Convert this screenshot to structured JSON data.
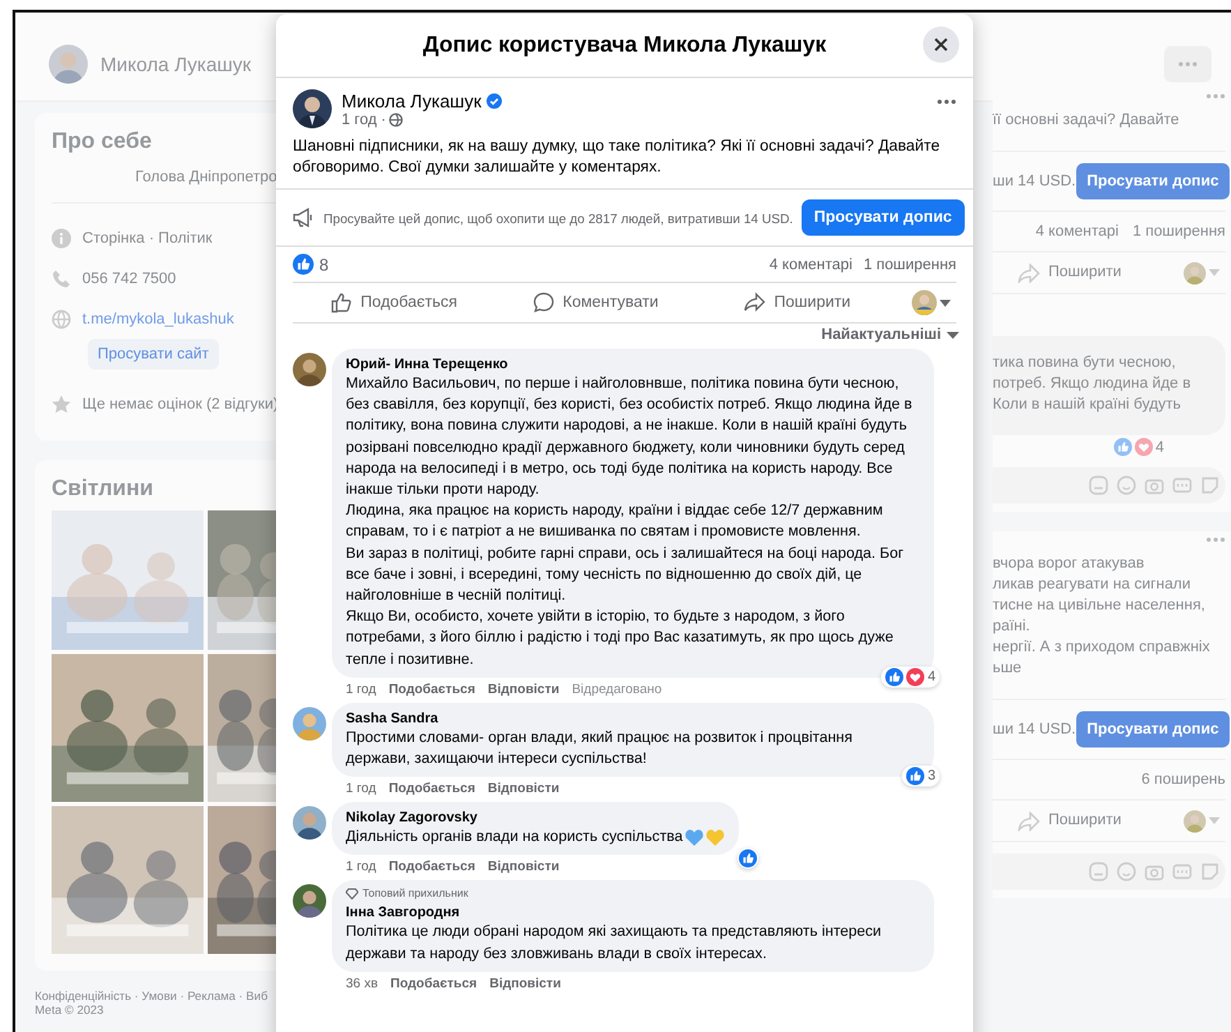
{
  "page_header": {
    "name": "Микола Лукашук"
  },
  "about": {
    "title": "Про себе",
    "bio": "Голова Дніпропетро",
    "items": [
      {
        "kind": "info",
        "text": "Сторінка · Політик"
      },
      {
        "kind": "phone",
        "text": "056 742 7500"
      },
      {
        "kind": "link",
        "text": "t.me/mykola_lukashuk"
      }
    ],
    "promote_button": "Просувати сайт",
    "rating": "Ще немає оцінок (2 відгуки)"
  },
  "photos": {
    "title": "Світлини"
  },
  "footer": [
    "Конфіденційність · Умови · Реклама · Виб",
    "Meta © 2023"
  ],
  "right_cards": [
    {
      "text_lines": [
        "її основні задачі? Давайте"
      ],
      "promo_fragment": "ши 14 USD.",
      "promote_button": "Просувати допис",
      "stats": [
        "4 коментарі",
        "1 поширення"
      ],
      "share": "Поширити",
      "comment_lines": [
        "тика повина бути чесною,",
        "потреб. Якщо людина йде в",
        "Коли в нашій країні будуть"
      ],
      "reaction_count": "4"
    },
    {
      "text_lines": [
        "вчора ворог атакував",
        "ликав реагувати на сигнали",
        "тисне на цивільне населення,",
        "раїні.",
        "нергії. А з приходом справжніх",
        "ьше"
      ],
      "promo_fragment": "ши 14 USD.",
      "promote_button": "Просувати допис",
      "stats": [
        "6 поширень"
      ],
      "share": "Поширити"
    }
  ],
  "modal": {
    "title": "Допис користувача Микола Лукашук",
    "post": {
      "author": "Микола Лукашук",
      "verified": true,
      "time": "1 год ·",
      "text": "Шановні підписники, як на вашу думку, що таке політика? Які її основні задачі? Давайте обговоримо. Свої думки залишайте у коментарях.",
      "promo": {
        "text": "Просувайте цей допис, щоб охопити ще до 2817 людей, витративши 14 USD.",
        "button": "Просувати допис"
      },
      "likes": "8",
      "stats": [
        "4 коментарі",
        "1 поширення"
      ],
      "actions": [
        {
          "kind": "like",
          "label": "Подобається"
        },
        {
          "kind": "comment",
          "label": "Коментувати"
        },
        {
          "kind": "share",
          "label": "Поширити"
        }
      ],
      "sort": "Найактуальніші"
    },
    "comments": [
      {
        "author": "Юрий- Инна Терещенко",
        "paragraphs": [
          "Михайло Васильович, по перше і найголовнвше, політика повина бути чесною, без свавілля, без корупції, без користі, без особистіх потреб. Якщо людина йде в політику, вона повина служити народові, а не інакше. Коли в нашій країні будуть розірвані повселюдно крадії державного бюджету, коли чиновники будуть серед народа на велосипеді і в метро, ось тоді буде політика на користь народу. Все інакше тільки проти народу.",
          "Людина, яка працює на користь народу, країни і віддає себе 12/7 державним справам, то і є патріот а не вишиванка по святам і промовисте мовлення.",
          "Ви зараз в політиці, робите гарні справи, ось і залишайтеся на боці народа. Бог все баче і зовні, і всередині, тому чесність по відношенню до своїх дій, це найголовніше в чесній політиці.",
          "Якщо Ви, особисто, хочете увійти в історію, то будьте з народом, з його потребами, з його біллю і радістю і тоді про Вас казатимуть, як про щось дуже тепле і позитивне."
        ],
        "time": "1 год",
        "actions": [
          "Подобається",
          "Відповісти"
        ],
        "edited": "Відредаговано",
        "reactions": [
          {
            "kind": "like"
          },
          {
            "kind": "love"
          }
        ],
        "reaction_count": "4"
      },
      {
        "author": "Sasha Sandra",
        "paragraphs": [
          "Простими словами- орган влади, який працює на розвиток і процвітання держави, захищаючи інтереси суспільства!"
        ],
        "time": "1 год",
        "actions": [
          "Подобається",
          "Відповісти"
        ],
        "reactions": [
          {
            "kind": "like"
          }
        ],
        "reaction_count": "3"
      },
      {
        "author": "Nikolay Zagorovsky",
        "paragraphs": [
          "Діяльність органів влади на користь суспільства"
        ],
        "emoji": [
          {
            "kind": "blue_heart"
          },
          {
            "kind": "yellow_heart"
          }
        ],
        "time": "1 год",
        "actions": [
          "Подобається",
          "Відповісти"
        ],
        "reactions": [
          {
            "kind": "like"
          }
        ]
      },
      {
        "author": "Інна Завгородня",
        "badge": "Топовий прихильник",
        "paragraphs": [
          "Політика це люди обрані народом які захищають та представляють інтереси держави та народу без зловживань влади в своїх інтересах."
        ],
        "time": "36 хв",
        "actions": [
          "Подобається",
          "Відповісти"
        ]
      }
    ]
  }
}
